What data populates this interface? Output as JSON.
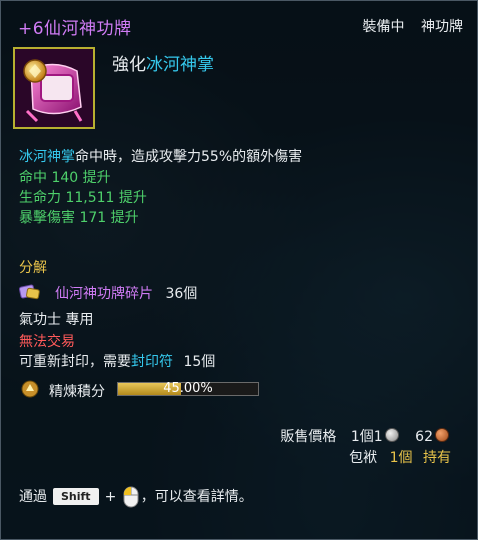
{
  "tooltip": {
    "item_name": "+6仙河神功牌",
    "status_equipped": "裝備中",
    "status_type": "神功牌",
    "enhance_prefix": "強化",
    "enhance_target": "冰河神掌",
    "effect_skill": "冰河神掌",
    "effect_text": "命中時，造成攻擊力55%的額外傷害",
    "stats": [
      {
        "label": "命中 140 提升"
      },
      {
        "label": "生命力 11,511 提升"
      },
      {
        "label": "暴擊傷害 171 提升"
      }
    ],
    "decompose_label": "分解",
    "fragment_name": "仙河神功牌碎片",
    "fragment_count": "36個",
    "class_restriction": "氣功士 專用",
    "no_trade": "無法交易",
    "reseal_prefix": "可重新封印，需要",
    "reseal_item": "封印符",
    "reseal_count": "15個",
    "refine_label": "精煉積分",
    "refine_percent_text": "45.00%",
    "refine_progress": 0.45,
    "sell_label": "販售價格",
    "sell_count": "1個",
    "sell_silver": "1",
    "sell_copper": "62",
    "bag_label": "包袱",
    "bag_count": "1個",
    "bag_status": "持有",
    "hint_prefix": "通過",
    "hint_key": "Shift",
    "hint_plus": "+",
    "hint_suffix": "，可以查看詳情。",
    "icons": {
      "item": "shen-gong-pai-icon",
      "fragment": "fragment-icon",
      "refine": "refine-icon",
      "silver": "silver-coin-icon",
      "copper": "copper-coin-icon",
      "mouse": "mouse-icon"
    },
    "colors": {
      "title": "#d07cf5",
      "cyan": "#35c8ec",
      "green": "#4ed06b",
      "yellow": "#e8c34a",
      "red": "#ff5a5a"
    }
  }
}
